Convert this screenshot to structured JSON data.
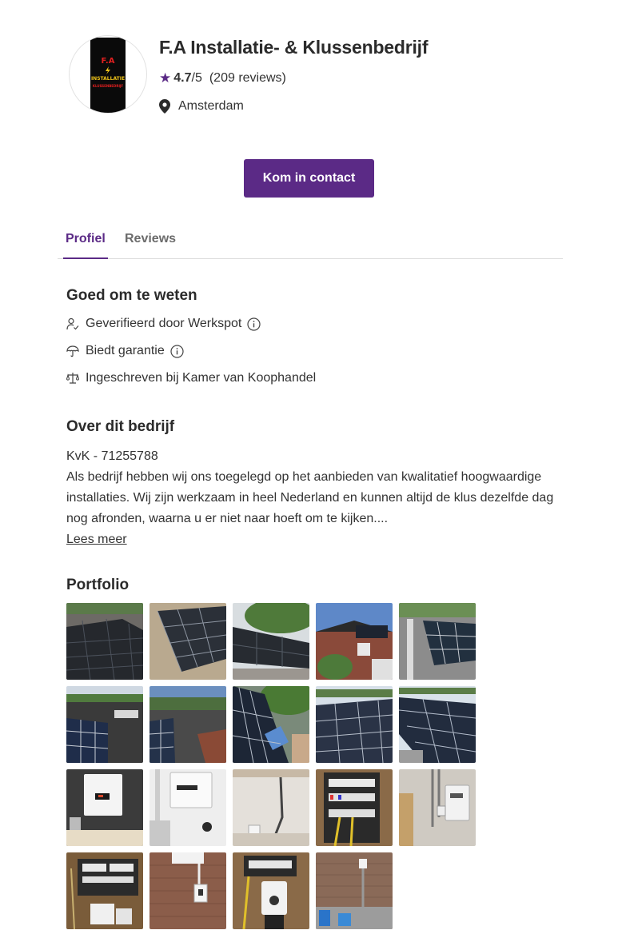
{
  "company": {
    "logo": {
      "alt_text": "F.A Installatie & Klussenbedrijf logo",
      "line1": "F.A",
      "line2": "INSTALLATIE",
      "line3": "KLUSSENBEDRIJF"
    },
    "name": "F.A Installatie- & Klussenbedrijf",
    "rating": "4.7",
    "rating_suffix": "/5",
    "reviews": "(209 reviews)",
    "location": "Amsterdam"
  },
  "contact_button": "Kom in contact",
  "tabs": [
    {
      "label": "Profiel",
      "active": true
    },
    {
      "label": "Reviews",
      "active": false
    }
  ],
  "good_to_know": {
    "title": "Goed om te weten",
    "items": [
      {
        "label": "Geverifieerd door Werkspot",
        "icon": "verified-user-icon",
        "has_info": true
      },
      {
        "label": "Biedt garantie",
        "icon": "umbrella-icon",
        "has_info": true
      },
      {
        "label": "Ingeschreven bij Kamer van Koophandel",
        "icon": "scales-icon",
        "has_info": false
      }
    ]
  },
  "about": {
    "title": "Over dit bedrijf",
    "kvk": "KvK - 71255788",
    "description": "Als bedrijf hebben wij ons toegelegd op het aanbieden van kwalitatief hoogwaardige installaties. Wij zijn werkzaam in heel Nederland en kunnen altijd de klus dezelfde dag nog afronden, waarna u er niet naar hoeft om te kijken....",
    "read_more": "Lees meer"
  },
  "portfolio": {
    "title": "Portfolio",
    "photos": [
      "solar panels on roof",
      "solar panels on gravel roof",
      "solar panels with trees",
      "house roof with solar panels",
      "solar panels on flat roof",
      "solar panels on flat roof",
      "solar panels rooftop view",
      "solar panels with trees",
      "solar panel rows",
      "solar panel rows",
      "inverter on wall",
      "inverter on wall",
      "meter cupboard",
      "fuse box",
      "inverter and conduit",
      "meter cupboard",
      "wall socket on brick",
      "electric meter",
      "conduit on brick wall"
    ]
  },
  "colors": {
    "brand": "#5b2a86",
    "text": "#333333"
  }
}
